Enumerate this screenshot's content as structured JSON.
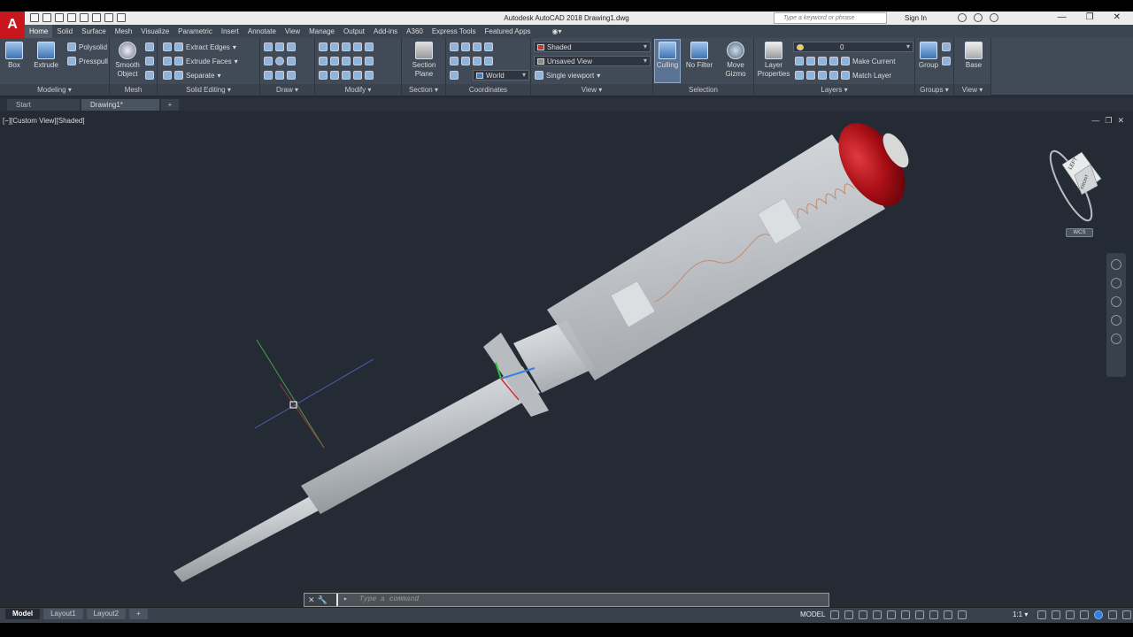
{
  "app": {
    "title": "Autodesk AutoCAD 2018   Drawing1.dwg",
    "logo": "A",
    "search_placeholder": "Type a keyword or phrase",
    "sign_in": "Sign In",
    "window_buttons": [
      "—",
      "❐",
      "✕"
    ]
  },
  "ribbon_tabs": [
    "Home",
    "Solid",
    "Surface",
    "Mesh",
    "Visualize",
    "Parametric",
    "Insert",
    "Annotate",
    "View",
    "Manage",
    "Output",
    "Add-ins",
    "A360",
    "Express Tools",
    "Featured Apps"
  ],
  "active_tab": "Home",
  "panels": {
    "modeling": {
      "title": "Modeling ▾",
      "box": "Box",
      "extrude": "Extrude",
      "polysolid": "Polysolid",
      "presspull": "Presspull"
    },
    "mesh": {
      "title": "Mesh",
      "smooth_object_1": "Smooth",
      "smooth_object_2": "Object"
    },
    "solid_editing": {
      "title": "Solid Editing ▾",
      "extract_edges": "Extract Edges",
      "extrude_faces": "Extrude Faces",
      "separate": "Separate"
    },
    "draw": {
      "title": "Draw ▾"
    },
    "modify": {
      "title": "Modify ▾"
    },
    "section": {
      "title": "Section ▾",
      "section_plane_1": "Section",
      "section_plane_2": "Plane"
    },
    "coordinates": {
      "title": "Coordinates",
      "ucs_value": "World"
    },
    "view": {
      "title": "View ▾",
      "visual_style": "Shaded",
      "named_view": "Unsaved View",
      "viewport_config": "Single viewport"
    },
    "selection": {
      "title": "Selection",
      "culling": "Culling",
      "no_filter": "No Filter",
      "move_gizmo_1": "Move",
      "move_gizmo_2": "Gizmo"
    },
    "layers": {
      "title": "Layers ▾",
      "layer_properties_1": "Layer",
      "layer_properties_2": "Properties",
      "current_layer": "0",
      "make_current": "Make Current",
      "match_layer": "Match Layer"
    },
    "groups": {
      "title": "Groups ▾",
      "group": "Group"
    },
    "view2": {
      "title": "View ▾",
      "base": "Base"
    }
  },
  "file_tabs": [
    "Start",
    "Drawing1*",
    "+"
  ],
  "viewport": {
    "label": "[−][Custom View][Shaded]",
    "controls": [
      "—",
      "❐",
      "✕"
    ],
    "viewcube_top": "LEFT",
    "viewcube_front": "FRONT",
    "wcs_label": "WCS"
  },
  "command_line": {
    "placeholder": "Type a command"
  },
  "layout_tabs": [
    "Model",
    "Layout1",
    "Layout2",
    "+"
  ],
  "status": {
    "model": "MODEL",
    "scale": "1:1 ▾"
  },
  "colors": {
    "ribbon": "#414a57",
    "viewport": "#252b35",
    "cap_red": "#b0101a",
    "logo_red": "#c8161d"
  }
}
